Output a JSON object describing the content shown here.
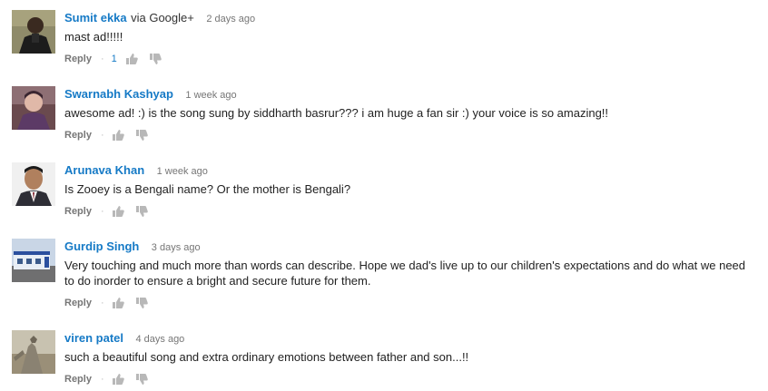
{
  "comments": [
    {
      "author": "Sumit ekka",
      "via": "via Google+",
      "time": "2 days ago",
      "text": "mast ad!!!!!",
      "reply": "Reply",
      "separator": "·",
      "like_count": "1"
    },
    {
      "author": "Swarnabh Kashyap",
      "time": "1 week ago",
      "text": "awesome ad! :) is the song sung by siddharth basrur??? i am huge a fan sir :) your voice is so amazing!!",
      "reply": "Reply",
      "separator": "·"
    },
    {
      "author": "Arunava Khan",
      "time": "1 week ago",
      "text": "Is Zooey is a Bengali name? Or the mother is Bengali?",
      "reply": "Reply",
      "separator": "·"
    },
    {
      "author": "Gurdip Singh",
      "time": "3 days ago",
      "text": "Very touching and much more than words can describe. Hope we dad's live up to our children's expectations and do what we need to do inorder to ensure a bright and secure future for them.",
      "reply": "Reply",
      "separator": "·"
    },
    {
      "author": "viren patel",
      "time": "4 days ago",
      "text": "such a beautiful song and extra ordinary emotions between father and son...!!",
      "reply": "Reply",
      "separator": "·"
    }
  ],
  "icons": {
    "like": "thumbs-up-icon",
    "dislike": "thumbs-down-icon"
  },
  "colors": {
    "author_link": "#167ac6",
    "meta_text": "#767676",
    "icon_gray": "#b8b8b8"
  }
}
